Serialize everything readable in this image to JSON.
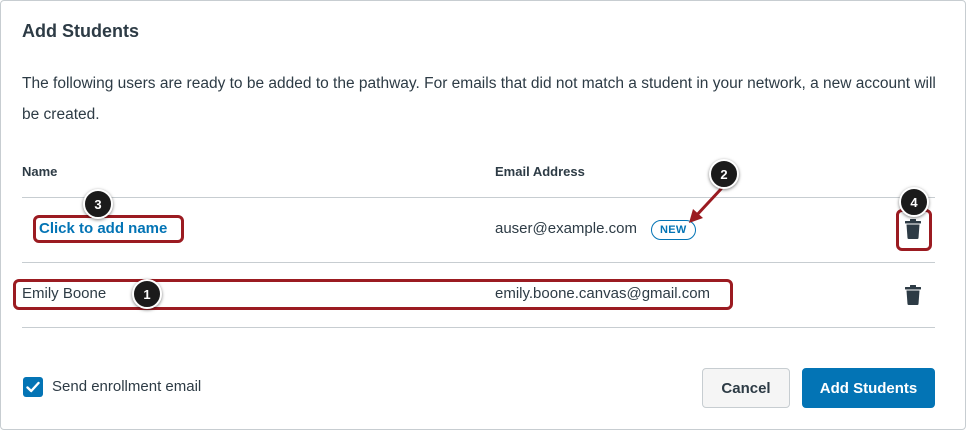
{
  "dialog": {
    "title": "Add Students",
    "description": "The following users are ready to be added to the pathway. For emails that did not match a student in your network, a new account will be created."
  },
  "table": {
    "columns": [
      "Name",
      "Email Address"
    ],
    "rows": [
      {
        "name": "Click to add name",
        "email": "auser@example.com",
        "badge": "NEW",
        "delete_icon": "trash-icon"
      },
      {
        "name": "Emily Boone",
        "email": "emily.boone.canvas@gmail.com",
        "delete_icon": "trash-icon"
      }
    ]
  },
  "callouts": [
    "1",
    "2",
    "3",
    "4"
  ],
  "footer": {
    "checkbox_label": "Send enrollment email",
    "checkbox_checked": true,
    "cancel_label": "Cancel",
    "add_label": "Add Students"
  },
  "colors": {
    "accent": "#0374b5",
    "highlight": "#9b1b21",
    "text": "#2d3b45",
    "divider": "#c7cdd1"
  }
}
